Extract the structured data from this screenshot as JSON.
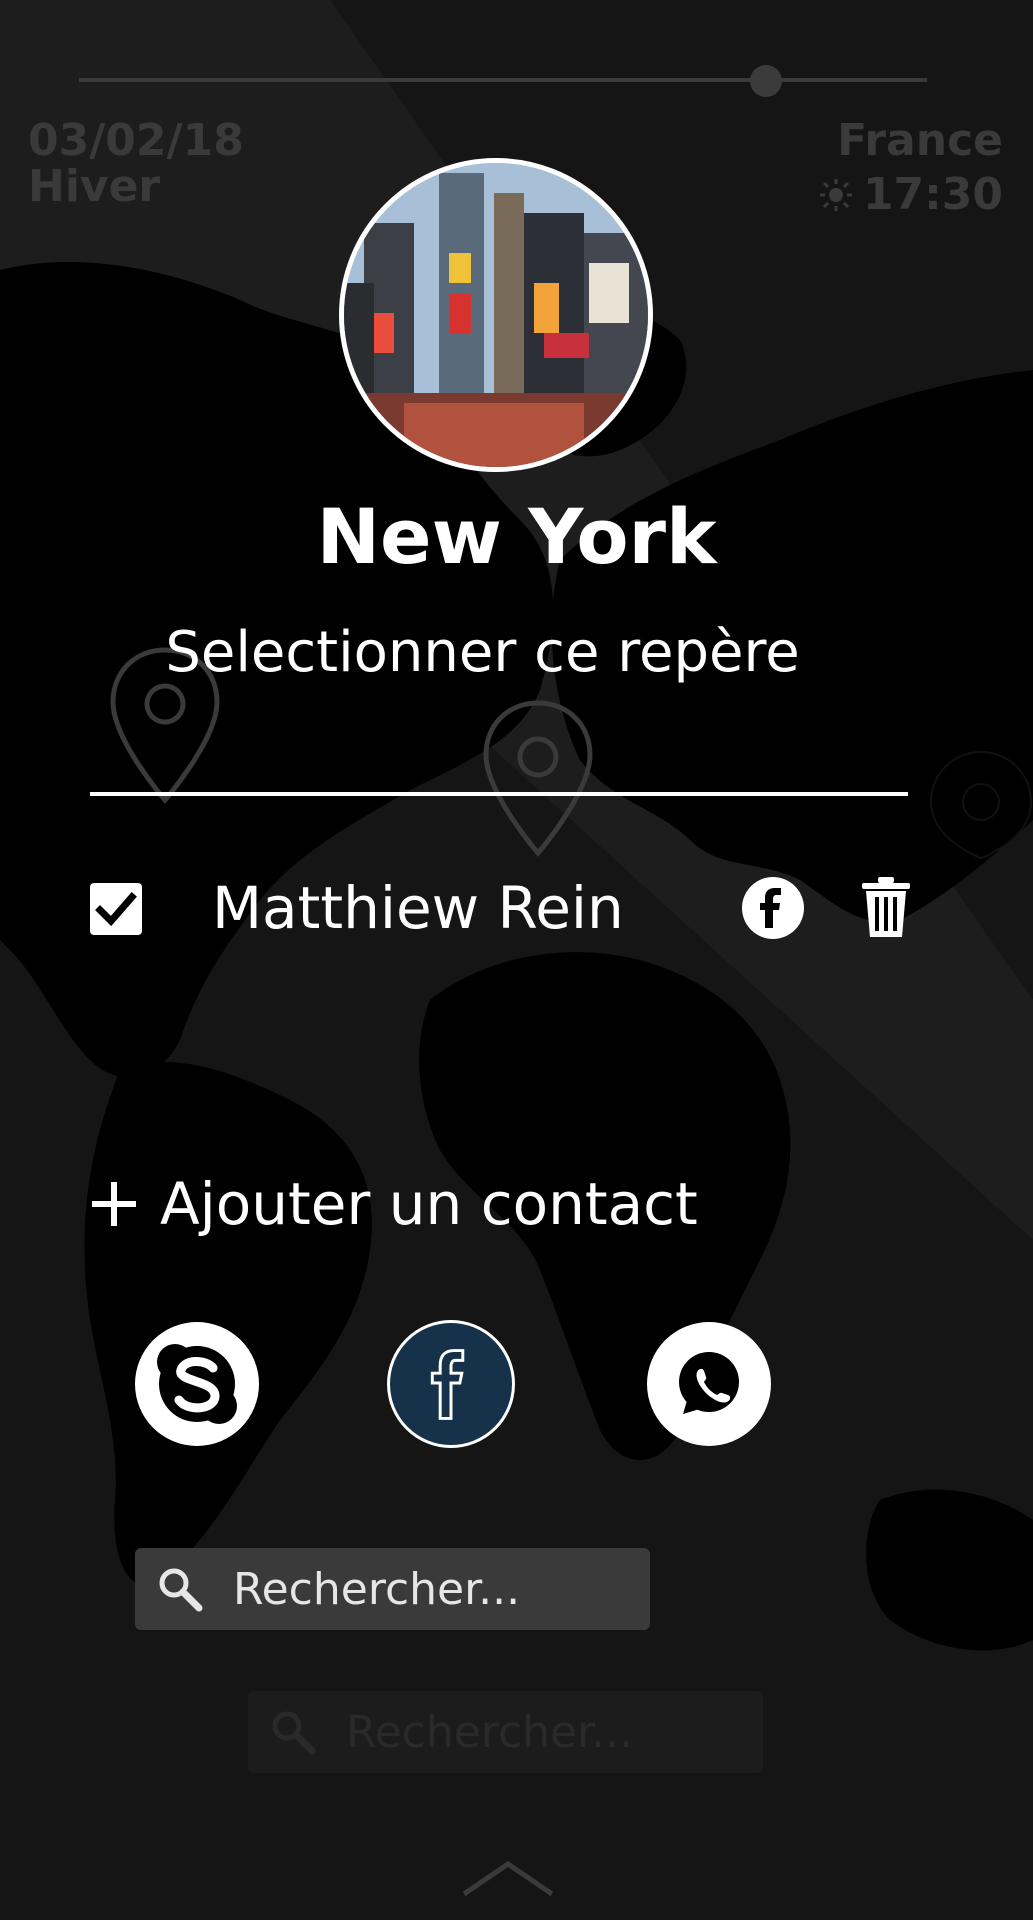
{
  "status": {
    "date": "03/02/18",
    "season": "Hiver",
    "country": "France",
    "time": "17:30",
    "weather_icon": "sun-icon"
  },
  "timeline_slider": {
    "value": 0.81
  },
  "location": {
    "name": "New York",
    "select_label": "Selectionner ce repère",
    "photo_icon": "city-photo"
  },
  "contacts": [
    {
      "name": "Matthiew Rein",
      "checked": true,
      "network_icon": "facebook-icon",
      "delete_icon": "trash-icon"
    }
  ],
  "add_contact": {
    "label": "Ajouter un contact",
    "icon": "plus-icon"
  },
  "social_networks": [
    {
      "name": "skype",
      "icon": "skype-icon",
      "active": false
    },
    {
      "name": "facebook",
      "icon": "facebook-icon",
      "active": true,
      "color": "#15324a"
    },
    {
      "name": "whatsapp",
      "icon": "whatsapp-icon",
      "active": false
    }
  ],
  "search": {
    "placeholder": "Rechercher..."
  },
  "search_ghost": {
    "placeholder": "Rechercher..."
  },
  "bottom_handle": {
    "icon": "chevron-up-icon"
  },
  "colors": {
    "background": "#121212",
    "map": "#000000",
    "accent_facebook": "#15324a",
    "muted_text": "#3a3a3a"
  }
}
